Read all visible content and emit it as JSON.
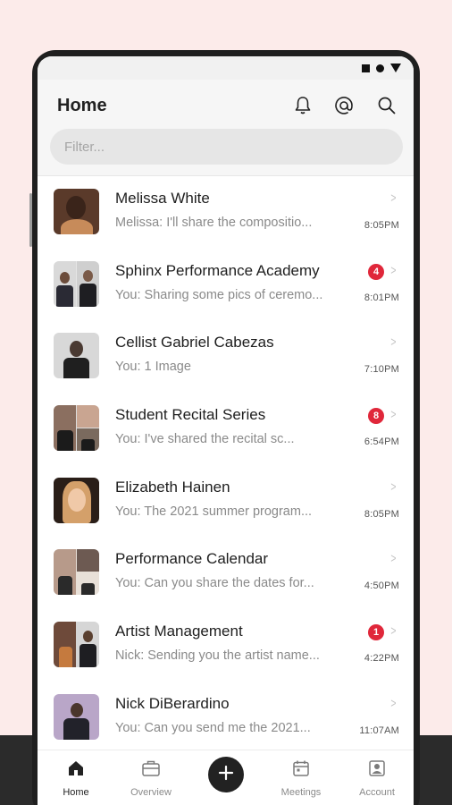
{
  "header": {
    "title": "Home",
    "icons": [
      "bell-icon",
      "at-icon",
      "search-icon"
    ],
    "filter_placeholder": "Filter..."
  },
  "conversations": [
    {
      "name": "Melissa White",
      "preview": "Melissa:  I'll share the compositio...",
      "time": "8:05PM",
      "badge": null,
      "avatar_colors": [
        "#5a3a2a"
      ]
    },
    {
      "name": "Sphinx Performance Academy",
      "preview": "You: Sharing some pics of ceremo...",
      "time": "8:01PM",
      "badge": "4",
      "avatar_colors": [
        "#d9d9d9",
        "#cfcfcf"
      ]
    },
    {
      "name": "Cellist Gabriel Cabezas",
      "preview": "You: 1 Image",
      "time": "7:10PM",
      "badge": null,
      "avatar_colors": [
        "#d8d8d8"
      ]
    },
    {
      "name": "Student Recital Series",
      "preview": "You: I've shared the recital sc...",
      "time": "6:54PM",
      "badge": "8",
      "avatar_colors": [
        "#8b6f60",
        "#c9a591",
        "#7a6a5e"
      ]
    },
    {
      "name": "Elizabeth Hainen",
      "preview": "You: The 2021 summer program...",
      "time": "8:05PM",
      "badge": null,
      "avatar_colors": [
        "#c9a07a"
      ]
    },
    {
      "name": "Performance Calendar",
      "preview": "You: Can you share the dates for...",
      "time": "4:50PM",
      "badge": null,
      "avatar_colors": [
        "#b79a8a",
        "#6d5a52",
        "#e8e0d8"
      ]
    },
    {
      "name": "Artist Management",
      "preview": "Nick:  Sending you the artist name...",
      "time": "4:22PM",
      "badge": "1",
      "avatar_colors": [
        "#6e4a3a",
        "#d6d6d6"
      ]
    },
    {
      "name": "Nick DiBerardino",
      "preview": "You: Can you send me the 2021...",
      "time": "11:07AM",
      "badge": null,
      "avatar_colors": [
        "#b9a6c8"
      ]
    }
  ],
  "tabs": [
    {
      "label": "Home",
      "icon": "home-icon",
      "active": true
    },
    {
      "label": "Overview",
      "icon": "briefcase-icon",
      "active": false
    },
    {
      "label": "",
      "icon": "plus-icon",
      "active": false
    },
    {
      "label": "Meetings",
      "icon": "calendar-icon",
      "active": false
    },
    {
      "label": "Account",
      "icon": "account-icon",
      "active": false
    }
  ],
  "colors": {
    "badge": "#e0273a",
    "background": "#fcebea",
    "header": "#f6f6f6",
    "fab": "#222222"
  }
}
